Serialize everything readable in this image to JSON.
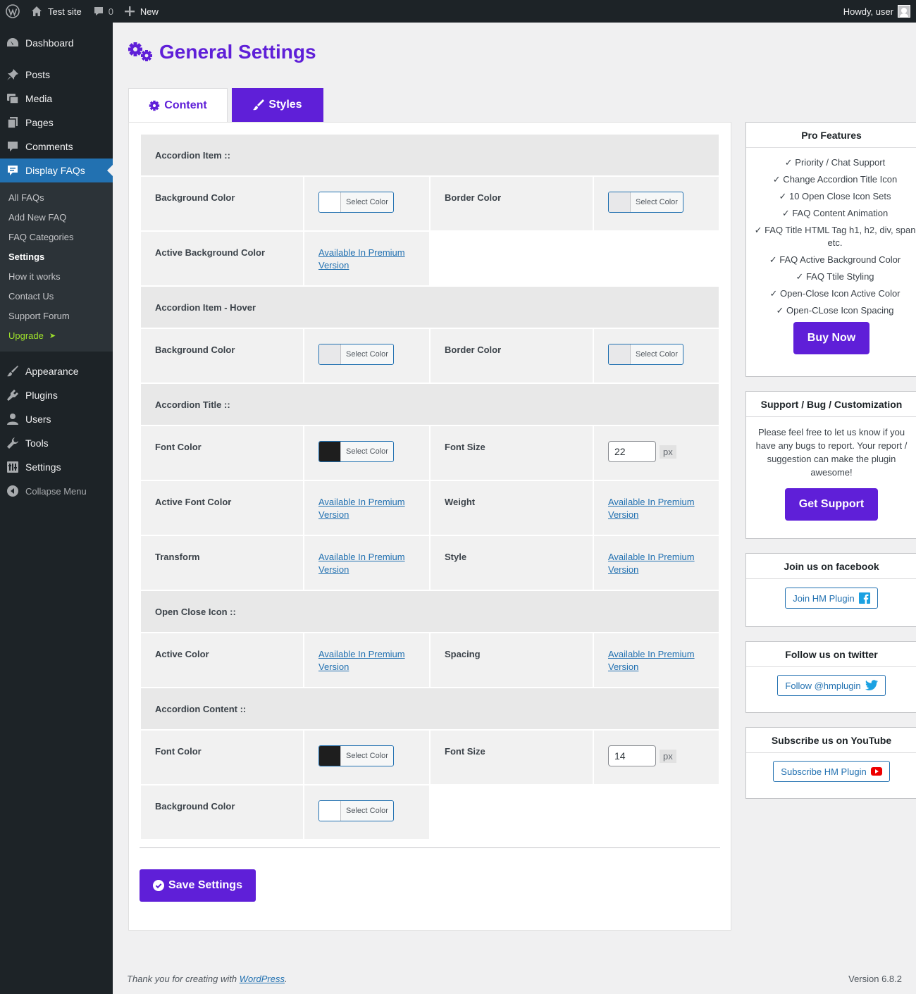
{
  "adminbar": {
    "site_name": "Test site",
    "comments_count": "0",
    "new_label": "New",
    "howdy": "Howdy, user"
  },
  "sidebar": {
    "top_items": [
      {
        "label": "Dashboard",
        "icon": "dashboard-icon"
      },
      {
        "label": "Posts",
        "icon": "pin-icon"
      },
      {
        "label": "Media",
        "icon": "media-icon"
      },
      {
        "label": "Pages",
        "icon": "pages-icon"
      },
      {
        "label": "Comments",
        "icon": "comment-icon"
      },
      {
        "label": "Display FAQs",
        "icon": "faq-icon"
      }
    ],
    "submenu": [
      "All FAQs",
      "Add New FAQ",
      "FAQ Categories",
      "Settings",
      "How it works",
      "Contact Us",
      "Support Forum"
    ],
    "upgrade": "Upgrade",
    "upgrade_arrow": "➤",
    "bottom_items": [
      {
        "label": "Appearance",
        "icon": "brush-icon"
      },
      {
        "label": "Plugins",
        "icon": "plugin-icon"
      },
      {
        "label": "Users",
        "icon": "user-icon"
      },
      {
        "label": "Tools",
        "icon": "wrench-icon"
      },
      {
        "label": "Settings",
        "icon": "settings-icon"
      }
    ],
    "collapse": "Collapse Menu"
  },
  "page": {
    "title": "General Settings",
    "tabs": {
      "content": "Content",
      "styles": "Styles"
    }
  },
  "styles": {
    "premium_line1": "Available In Premium",
    "premium_line2": "Version",
    "select_color": "Select Color",
    "unit_px": "px",
    "sections": {
      "item": "Accordion Item ::",
      "hover": "Accordion Item - Hover",
      "title": "Accordion Title ::",
      "icon": "Open Close Icon ::",
      "content": "Accordion Content ::"
    },
    "labels": {
      "background_color": "Background Color",
      "border_color": "Border Color",
      "active_background_color": "Active Background Color",
      "font_color": "Font Color",
      "font_size": "Font Size",
      "active_font_color": "Active Font Color",
      "weight": "Weight",
      "transform": "Transform",
      "style": "Style",
      "active_color": "Active Color",
      "spacing": "Spacing"
    },
    "values": {
      "title_font_size": "22",
      "content_font_size": "14"
    },
    "colors": {
      "white": "#ffffff",
      "light_gray": "#e8e8ea",
      "dark": "#1e1e1e",
      "accent": "#5f1fd8"
    },
    "save_label": "Save Settings"
  },
  "pro": {
    "title": "Pro Features",
    "items": [
      "✓ Priority / Chat Support",
      "✓ Change Accordion Title Icon",
      "✓ 10 Open Close Icon Sets",
      "✓ FAQ Content Animation",
      "✓ FAQ Title HTML Tag h1, h2, div, span etc.",
      "✓ FAQ Active Background Color",
      "✓ FAQ Ttile Styling",
      "✓ Open-Close Icon Active Color",
      "✓ Open-CLose Icon Spacing"
    ],
    "buy": "Buy Now"
  },
  "support": {
    "title": "Support / Bug / Customization",
    "text": "Please feel free to let us know if you have any bugs to report. Your report / suggestion can make the plugin awesome!",
    "button": "Get Support"
  },
  "facebook": {
    "title": "Join us on facebook",
    "button": "Join HM Plugin"
  },
  "twitter": {
    "title": "Follow us on twitter",
    "button": "Follow @hmplugin"
  },
  "youtube": {
    "title": "Subscribe us on YouTube",
    "button": "Subscribe HM Plugin"
  },
  "footer": {
    "thanks": "Thank you for creating with",
    "wordpress": "WordPress",
    "period": ".",
    "version": "Version 6.8.2"
  }
}
